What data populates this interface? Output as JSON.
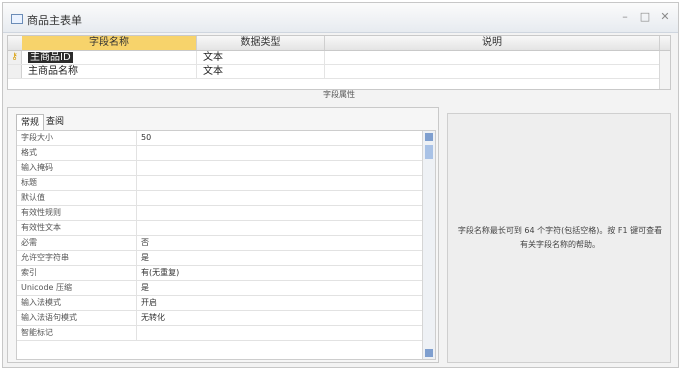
{
  "window": {
    "title": "商品主表单",
    "buttons": {
      "minimize": "–",
      "maximize": "□",
      "close": "✕"
    }
  },
  "grid": {
    "headers": [
      "字段名称",
      "数据类型",
      "说明"
    ],
    "rows": [
      {
        "name": "主商品ID",
        "type": "文本",
        "desc": ""
      },
      {
        "name": "主商品名称",
        "type": "文本",
        "desc": ""
      }
    ]
  },
  "properties_label": "字段属性",
  "tabs": {
    "general": "常规",
    "lookup": "查阅"
  },
  "properties": [
    {
      "label": "字段大小",
      "value": "50"
    },
    {
      "label": "格式",
      "value": ""
    },
    {
      "label": "输入掩码",
      "value": ""
    },
    {
      "label": "标题",
      "value": ""
    },
    {
      "label": "默认值",
      "value": ""
    },
    {
      "label": "有效性规则",
      "value": ""
    },
    {
      "label": "有效性文本",
      "value": ""
    },
    {
      "label": "必需",
      "value": "否"
    },
    {
      "label": "允许空字符串",
      "value": "是"
    },
    {
      "label": "索引",
      "value": "有(无重复)"
    },
    {
      "label": "Unicode 压缩",
      "value": "是"
    },
    {
      "label": "输入法模式",
      "value": "开启"
    },
    {
      "label": "输入法语句模式",
      "value": "无转化"
    },
    {
      "label": "智能标记",
      "value": ""
    }
  ],
  "help": "字段名称最长可到 64 个字符(包括空格)。按 F1 键可查看有关字段名称的帮助。"
}
